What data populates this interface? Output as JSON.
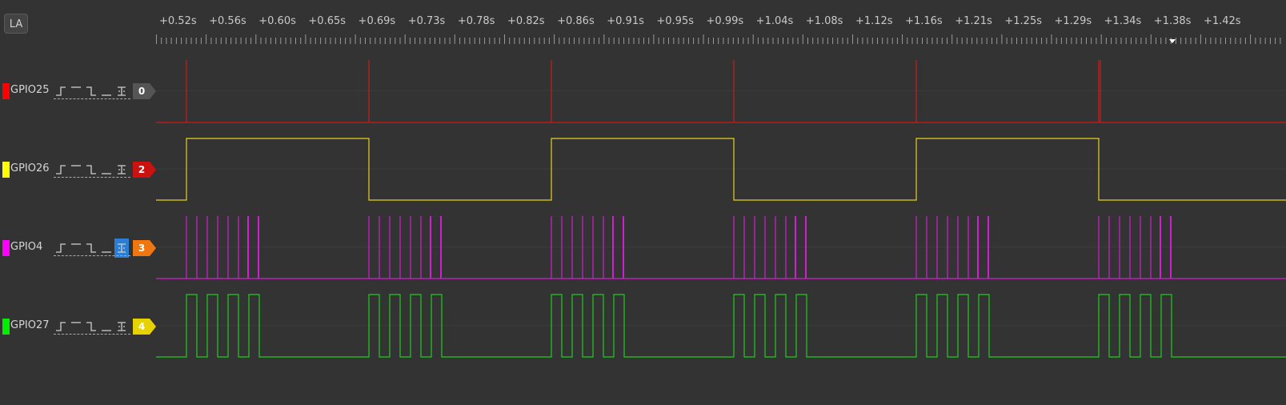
{
  "toolbar": {
    "la_label": "LA"
  },
  "ruler": {
    "labels": [
      "+0.52s",
      "+0.56s",
      "+0.60s",
      "+0.65s",
      "+0.69s",
      "+0.73s",
      "+0.78s",
      "+0.82s",
      "+0.86s",
      "+0.91s",
      "+0.95s",
      "+0.99s",
      "+1.04s",
      "+1.08s",
      "+1.12s",
      "+1.16s",
      "+1.21s",
      "+1.25s",
      "+1.29s",
      "+1.34s",
      "+1.38s",
      "+1.42s"
    ]
  },
  "channels": [
    {
      "name": "GPIO25",
      "index": "0",
      "color": "#ff0000",
      "trace_color": "#cc1a1a",
      "tag_color": "#555555",
      "tag_text_color": "#ffffff",
      "trigger_active": false
    },
    {
      "name": "GPIO26",
      "index": "2",
      "color": "#ffff00",
      "trace_color": "#e6d21e",
      "tag_color": "#cc1111",
      "tag_text_color": "#ffffff",
      "trigger_active": false
    },
    {
      "name": "GPIO4",
      "index": "3",
      "color": "#ff00ff",
      "trace_color": "#d21ed2",
      "tag_color": "#ee7711",
      "tag_text_color": "#ffffff",
      "trigger_active": true
    },
    {
      "name": "GPIO27",
      "index": "4",
      "color": "#00ee00",
      "trace_color": "#22cc22",
      "tag_color": "#e6d200",
      "tag_text_color": "#ffffff",
      "trigger_active": false
    }
  ],
  "trigger_icons": [
    "rising-edge-icon",
    "high-level-icon",
    "falling-edge-icon",
    "low-level-icon",
    "any-edge-icon"
  ]
}
